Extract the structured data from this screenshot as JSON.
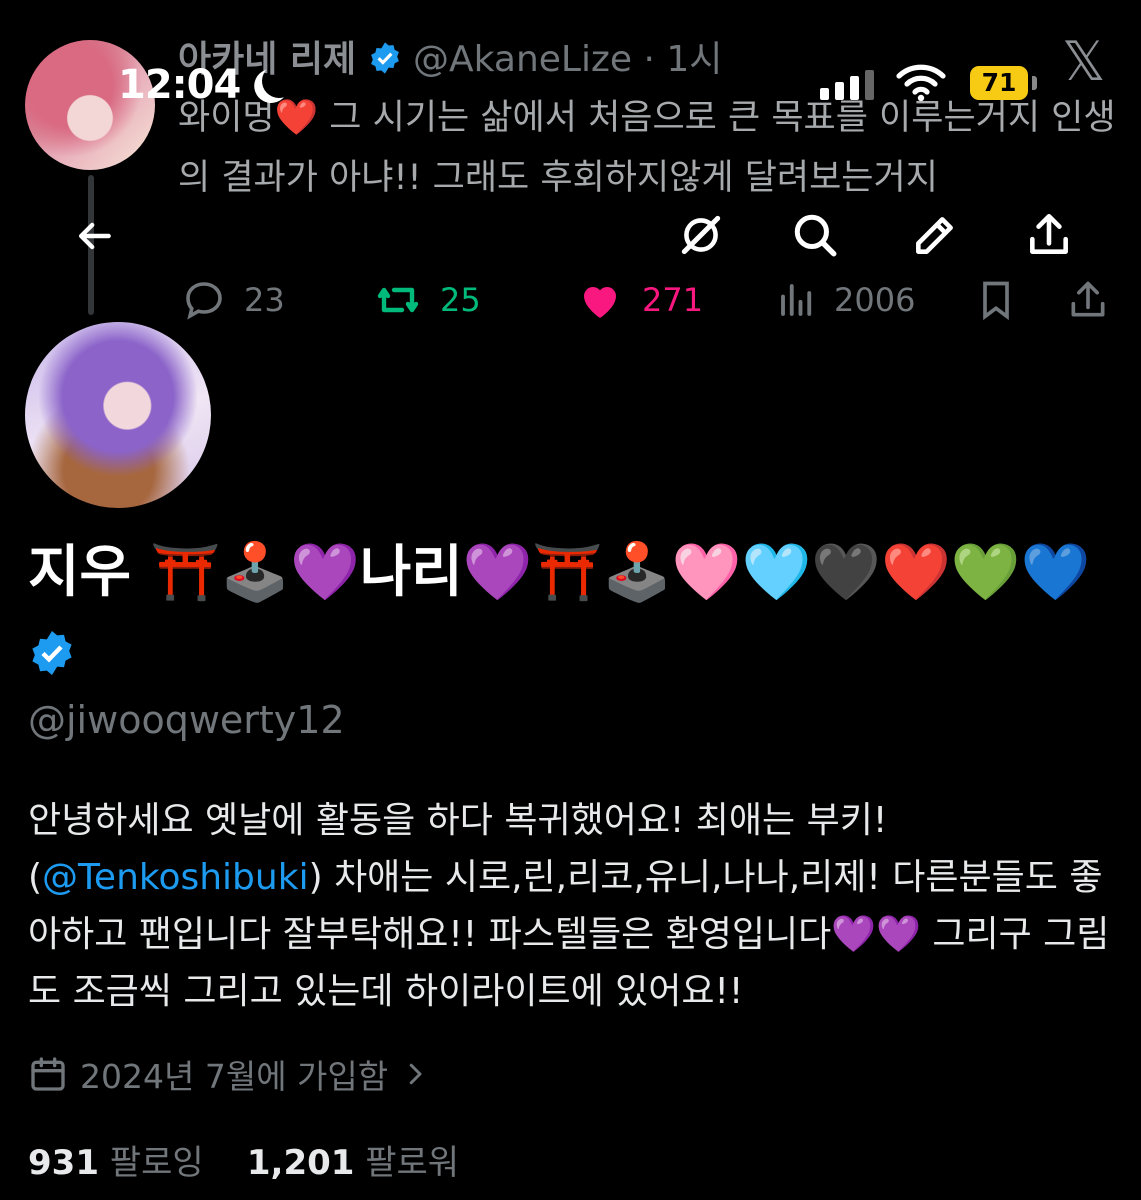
{
  "status_bar": {
    "time": "12:04",
    "battery": "71"
  },
  "quoted_tweet": {
    "name": "아카네 리제",
    "handle": "@AkaneLize",
    "separator": "·",
    "time_ago": "1시",
    "text": "와이멍❤️ 그 시기는 삶에서 처음으로 큰 목표를 이루는거지 인생의 결과가 아냐!! 그래도 후회하지않게 달려보는거지",
    "replies": "23",
    "retweets": "25",
    "likes": "271",
    "views": "2006",
    "colors": {
      "retweet": "#00ba7c",
      "like": "#f91880"
    }
  },
  "profile": {
    "display_name": "지우 ⛩️🕹️💜나리💜⛩️🕹️🩷🩵🖤❤️💚💙",
    "handle": "@jiwooqwerty12",
    "bio_part1": "안녕하세요 옛날에 활동을 하다 복귀했어요! 최애는 부키! (",
    "bio_link": "@Tenkoshibuki",
    "bio_part2": ") 차애는 시로,린,리코,유니,나나,리제! 다른분들도 좋아하고 팬입니다 잘부탁해요!! 파스텔들은 환영입니다💜💜 그리구 그림도 조금씩 그리고 있는데 하이라이트에 있어요!!",
    "joined": "2024년 7월에 가입함",
    "following_count": "931",
    "following_label": "팔로잉",
    "followers_count": "1,201",
    "followers_label": "팔로워",
    "colors": {
      "link": "#1d9bf0",
      "verified": "#1d9bf0"
    }
  }
}
